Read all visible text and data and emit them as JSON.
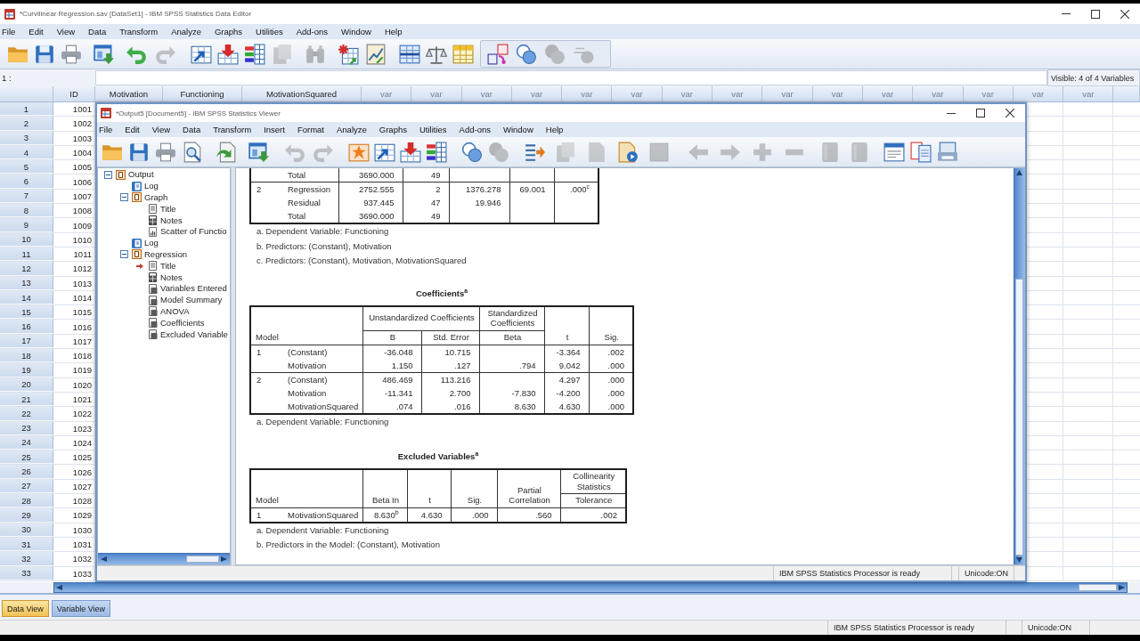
{
  "data_editor": {
    "title": "*Curvilinear Regression.sav [DataSet1] - IBM SPSS Statistics Data Editor",
    "menu": [
      "File",
      "Edit",
      "View",
      "Data",
      "Transform",
      "Analyze",
      "Graphs",
      "Utilities",
      "Add-ons",
      "Window",
      "Help"
    ],
    "toolbar": [
      {
        "disabled": false
      },
      {
        "disabled": false
      },
      {
        "disabled": false
      },
      {
        "disabled": false
      },
      {
        "disabled": false
      },
      {
        "disabled": true
      },
      {
        "disabled": false
      },
      {
        "disabled": false
      },
      {
        "disabled": false
      },
      {
        "disabled": true
      },
      {
        "disabled": true
      },
      {
        "disabled": false
      },
      {
        "disabled": false
      },
      {
        "disabled": false
      },
      {
        "disabled": false
      },
      {
        "disabled": false
      },
      {
        "disabled": false
      },
      {
        "disabled": false
      },
      {
        "disabled": true
      },
      {
        "disabled": true
      }
    ],
    "cell_reference": "1 :",
    "visible_label": "Visible: 4 of 4 Variables",
    "columns": [
      {
        "label": "ID",
        "defined": true
      },
      {
        "label": "Motivation",
        "defined": true
      },
      {
        "label": "Functioning",
        "defined": true
      },
      {
        "label": "MotivationSquared",
        "defined": true
      },
      {
        "label": "var",
        "defined": false
      },
      {
        "label": "var",
        "defined": false
      },
      {
        "label": "var",
        "defined": false
      },
      {
        "label": "var",
        "defined": false
      },
      {
        "label": "var",
        "defined": false
      },
      {
        "label": "var",
        "defined": false
      },
      {
        "label": "var",
        "defined": false
      },
      {
        "label": "var",
        "defined": false
      },
      {
        "label": "var",
        "defined": false
      },
      {
        "label": "var",
        "defined": false
      },
      {
        "label": "var",
        "defined": false
      },
      {
        "label": "var",
        "defined": false
      },
      {
        "label": "var",
        "defined": false
      },
      {
        "label": "var",
        "defined": false
      },
      {
        "label": "var",
        "defined": false
      }
    ],
    "rows": [
      {
        "number": "1",
        "id": "1001"
      },
      {
        "number": "2",
        "id": "1002"
      },
      {
        "number": "3",
        "id": "1003"
      },
      {
        "number": "4",
        "id": "1004"
      },
      {
        "number": "5",
        "id": "1005"
      },
      {
        "number": "6",
        "id": "1006"
      },
      {
        "number": "7",
        "id": "1007"
      },
      {
        "number": "8",
        "id": "1008"
      },
      {
        "number": "9",
        "id": "1009"
      },
      {
        "number": "10",
        "id": "1010"
      },
      {
        "number": "11",
        "id": "1011"
      },
      {
        "number": "12",
        "id": "1012"
      },
      {
        "number": "13",
        "id": "1013"
      },
      {
        "number": "14",
        "id": "1014"
      },
      {
        "number": "15",
        "id": "1015"
      },
      {
        "number": "16",
        "id": "1016"
      },
      {
        "number": "17",
        "id": "1017"
      },
      {
        "number": "18",
        "id": "1018"
      },
      {
        "number": "19",
        "id": "1019"
      },
      {
        "number": "20",
        "id": "1020"
      },
      {
        "number": "21",
        "id": "1021"
      },
      {
        "number": "22",
        "id": "1022"
      },
      {
        "number": "23",
        "id": "1023"
      },
      {
        "number": "24",
        "id": "1024"
      },
      {
        "number": "25",
        "id": "1025"
      },
      {
        "number": "26",
        "id": "1026"
      },
      {
        "number": "27",
        "id": "1027"
      },
      {
        "number": "28",
        "id": "1028"
      },
      {
        "number": "29",
        "id": "1029"
      },
      {
        "number": "30",
        "id": "1030"
      },
      {
        "number": "31",
        "id": "1031"
      },
      {
        "number": "32",
        "id": "1032"
      },
      {
        "number": "33",
        "id": "1033"
      }
    ],
    "view_tabs": [
      {
        "label": "Data View",
        "selected": true
      },
      {
        "label": "Variable View",
        "selected": false
      }
    ],
    "status_bar": [
      "IBM SPSS Statistics Processor is ready",
      "Unicode:ON"
    ]
  },
  "viewer": {
    "title": "*Output5 [Document5] - IBM SPSS Statistics Viewer",
    "menu": [
      "File",
      "Edit",
      "View",
      "Data",
      "Transform",
      "Insert",
      "Format",
      "Analyze",
      "Graphs",
      "Utilities",
      "Add-ons",
      "Window",
      "Help"
    ],
    "toolbar": [
      {
        "disabled": false
      },
      {
        "disabled": false
      },
      {
        "disabled": false
      },
      {
        "disabled": false
      },
      {
        "disabled": false
      },
      {
        "disabled": false
      },
      {
        "disabled": true
      },
      {
        "disabled": true
      },
      {
        "disabled": false
      },
      {
        "disabled": false
      },
      {
        "disabled": false
      },
      {
        "disabled": false
      },
      {
        "disabled": false
      },
      {
        "disabled": true
      },
      {
        "disabled": false
      },
      {
        "disabled": true
      },
      {
        "disabled": true
      },
      {
        "disabled": false
      },
      {
        "disabled": true
      },
      {
        "disabled": true
      },
      {
        "disabled": true
      },
      {
        "disabled": true
      },
      {
        "disabled": true
      },
      {
        "disabled": true
      },
      {
        "disabled": true
      },
      {
        "disabled": false
      },
      {
        "disabled": false
      },
      {
        "disabled": false
      }
    ],
    "outline": [
      {
        "label": "Output",
        "kind": "heading",
        "expanded": true,
        "current": false,
        "children": [
          {
            "label": "Log",
            "kind": "log",
            "current": false
          },
          {
            "label": "Graph",
            "kind": "heading",
            "expanded": true,
            "current": false,
            "children": [
              {
                "label": "Title",
                "kind": "title",
                "current": false
              },
              {
                "label": "Notes",
                "kind": "notes",
                "current": false
              },
              {
                "label": "Scatter of Functio",
                "kind": "chart",
                "current": false
              }
            ]
          },
          {
            "label": "Log",
            "kind": "log",
            "current": false
          },
          {
            "label": "Regression",
            "kind": "heading",
            "expanded": true,
            "current": false,
            "children": [
              {
                "label": "Title",
                "kind": "title",
                "current": true
              },
              {
                "label": "Notes",
                "kind": "notes",
                "current": false
              },
              {
                "label": "Variables Entered",
                "kind": "table",
                "current": false
              },
              {
                "label": "Model Summary",
                "kind": "table",
                "current": false
              },
              {
                "label": "ANOVA",
                "kind": "table",
                "current": false
              },
              {
                "label": "Coefficients",
                "kind": "table",
                "current": false
              },
              {
                "label": "Excluded Variable",
                "kind": "table",
                "current": false
              }
            ]
          }
        ]
      }
    ],
    "output": {
      "anova": {
        "rows": [
          {
            "column_2": "Total",
            "column_3": "3690.000",
            "column_4": "49"
          },
          {
            "column_1": "2",
            "column_2": "Regression",
            "column_3": "2752.555",
            "column_4": "2",
            "column_5": "1376.278",
            "column_6": "69.001",
            "column_7": ".000$^{c}$"
          },
          {
            "column_2": "Residual",
            "column_3": "937.445",
            "column_4": "47",
            "column_5": "19.946"
          },
          {
            "column_2": "Total",
            "column_3": "3690.000",
            "column_4": "49"
          }
        ],
        "footnotes": [
          "a. Dependent Variable: Functioning",
          "b. Predictors: (Constant), Motivation",
          "c. Predictors: (Constant), Motivation, MotivationSquared"
        ]
      },
      "coefficients": {
        "title": "Coefficients$^{a}$",
        "header": {
          "model": "Model",
          "unstandardized": "Unstandardized Coefficients",
          "b": "B",
          "std_error": "Std. Error",
          "standardized": "Standardized Coefficients",
          "beta": "Beta",
          "t": "t",
          "sig": "Sig."
        },
        "rows": [
          {
            "model": "1",
            "term": "(Constant)",
            "b": "-36.048",
            "std_error": "10.715",
            "t": "-3.364",
            "sig": ".002"
          },
          {
            "term": "Motivation",
            "b": "1.150",
            "std_error": ".127",
            "beta": ".794",
            "t": "9.042",
            "sig": ".000"
          },
          {
            "model": "2",
            "term": "(Constant)",
            "b": "486.469",
            "std_error": "113.216",
            "t": "4.297",
            "sig": ".000"
          },
          {
            "term": "Motivation",
            "b": "-11.341",
            "std_error": "2.700",
            "beta": "-7.830",
            "t": "-4.200",
            "sig": ".000"
          },
          {
            "term": "MotivationSquared",
            "b": ".074",
            "std_error": ".016",
            "beta": "8.630",
            "t": "4.630",
            "sig": ".000"
          }
        ],
        "footnotes": [
          "a. Dependent Variable: Functioning"
        ]
      },
      "excluded_variables": {
        "title": "Excluded Variables$^{a}$",
        "header": {
          "model": "Model",
          "beta_in": "Beta In",
          "t": "t",
          "sig": "Sig.",
          "partial_correlation": "Partial Correlation",
          "collinearity_statistics": "Collinearity Statistics",
          "tolerance": "Tolerance"
        },
        "rows": [
          {
            "model": "1",
            "term": "MotivationSquared",
            "beta_in": "8.630$^{b}$",
            "t": "4.630",
            "sig": ".000",
            "partial_correlation": ".560",
            "tolerance": ".002"
          }
        ],
        "footnotes": [
          "a. Dependent Variable: Functioning",
          "b. Predictors in the Model: (Constant), Motivation"
        ]
      }
    },
    "status_bar": [
      "IBM SPSS Statistics Processor is ready",
      "Unicode:ON"
    ]
  }
}
